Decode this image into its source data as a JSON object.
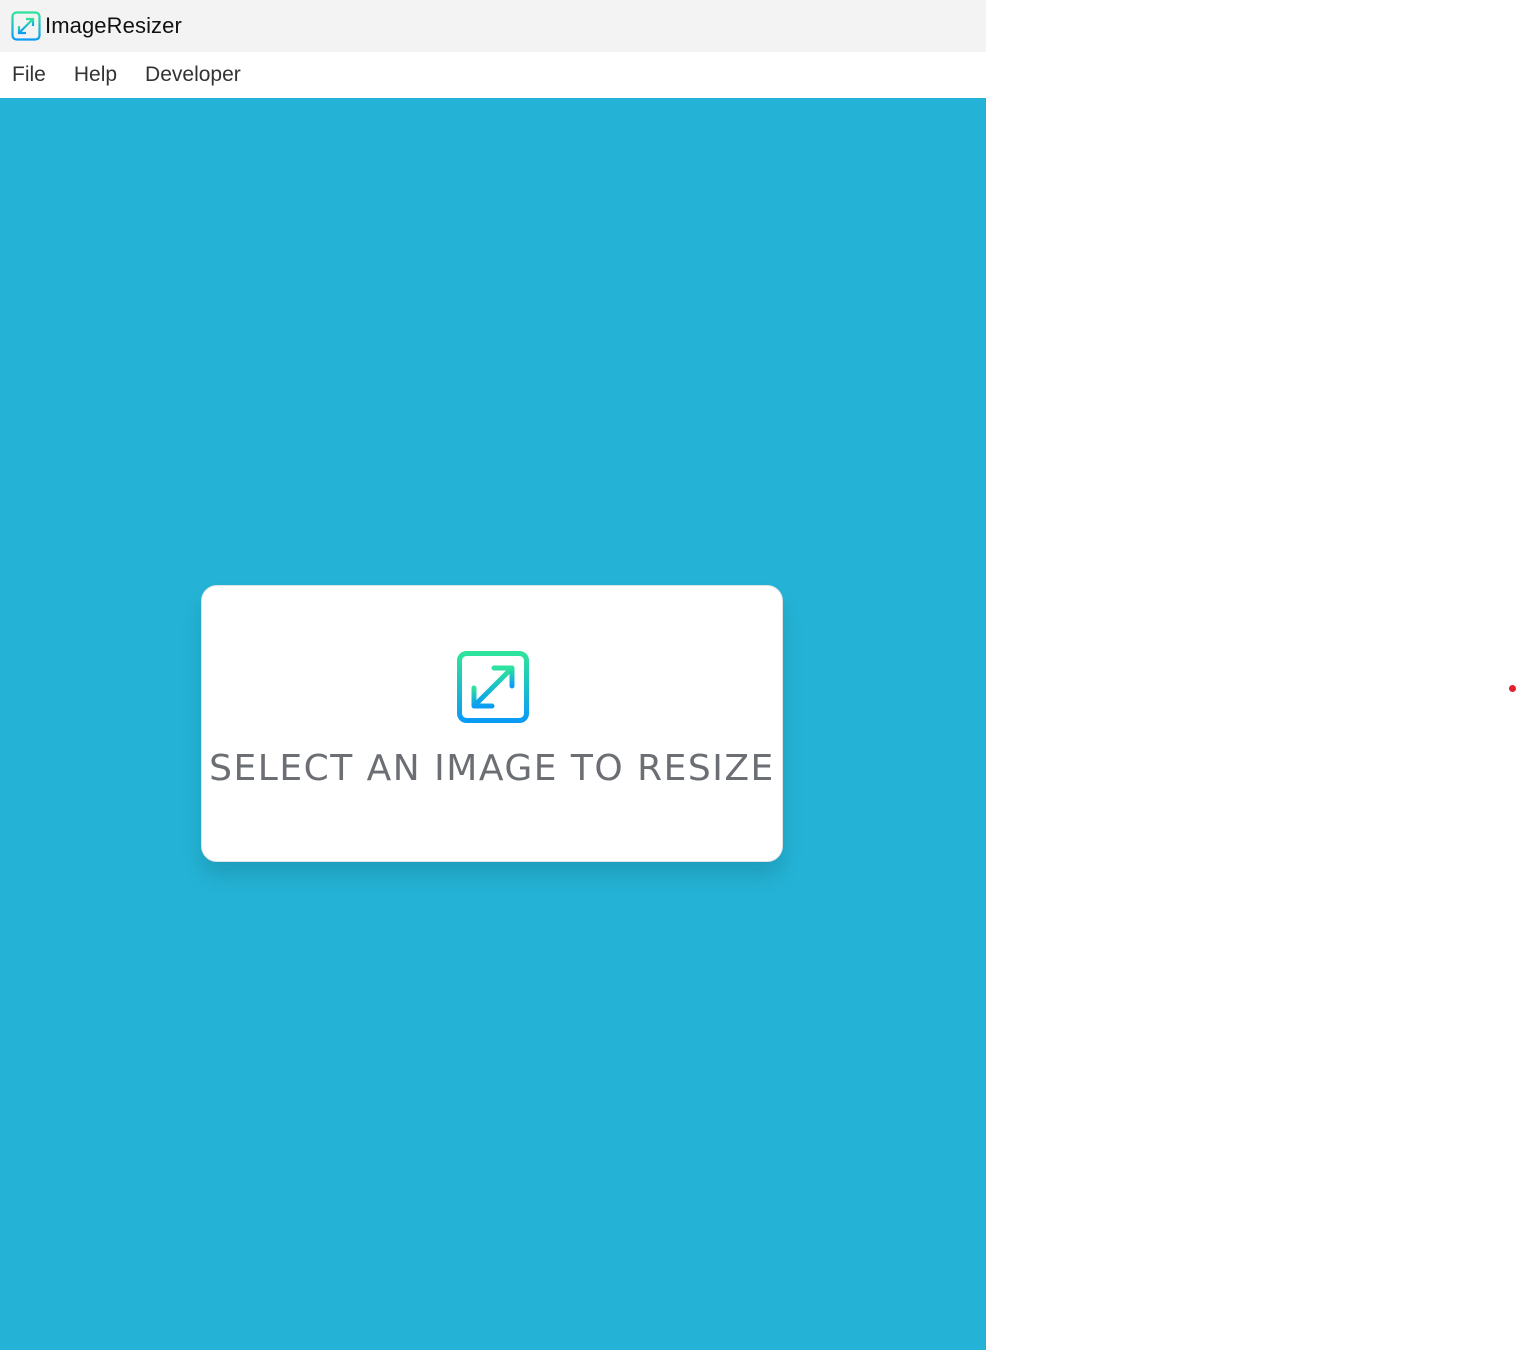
{
  "window": {
    "title": "ImageResizer",
    "icon": "resize-icon"
  },
  "menu": {
    "items": [
      {
        "label": "File"
      },
      {
        "label": "Help"
      },
      {
        "label": "Developer"
      }
    ]
  },
  "main": {
    "background_color": "#24b3d6",
    "select_card": {
      "icon": "resize-icon",
      "label": "SELECT AN IMAGE TO RESIZE"
    }
  },
  "colors": {
    "accent_gradient_start": "#2ee39b",
    "accent_gradient_end": "#0a9cf5",
    "card_text": "#6b6e73",
    "indicator_dot": "#e0212b"
  }
}
